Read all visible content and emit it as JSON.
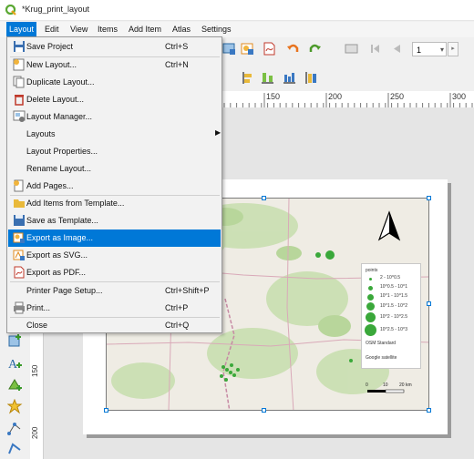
{
  "window": {
    "title": "*Krug_print_layout"
  },
  "menubar": [
    "Layout",
    "Edit",
    "View",
    "Items",
    "Add Item",
    "Atlas",
    "Settings"
  ],
  "layout_menu": {
    "items": [
      {
        "label": "Save Project",
        "shortcut": "Ctrl+S",
        "icon": "save-icon"
      },
      {
        "label": "New Layout...",
        "shortcut": "Ctrl+N",
        "icon": "new-layout-icon"
      },
      {
        "label": "Duplicate Layout...",
        "shortcut": "",
        "icon": "duplicate-icon"
      },
      {
        "label": "Delete Layout...",
        "shortcut": "",
        "icon": "delete-icon"
      },
      {
        "label": "Layout Manager...",
        "shortcut": "",
        "icon": "layout-manager-icon"
      },
      {
        "label": "Layouts",
        "shortcut": "",
        "icon": ""
      },
      {
        "label": "Layout Properties...",
        "shortcut": "",
        "icon": ""
      },
      {
        "label": "Rename Layout...",
        "shortcut": "",
        "icon": ""
      },
      {
        "label": "Add Pages...",
        "shortcut": "",
        "icon": "add-pages-icon"
      },
      {
        "label": "Add Items from Template...",
        "shortcut": "",
        "icon": "folder-icon"
      },
      {
        "label": "Save as Template...",
        "shortcut": "",
        "icon": "save-template-icon"
      },
      {
        "label": "Export as Image...",
        "shortcut": "",
        "icon": "export-image-icon"
      },
      {
        "label": "Export as SVG...",
        "shortcut": "",
        "icon": "export-svg-icon"
      },
      {
        "label": "Export as PDF...",
        "shortcut": "",
        "icon": "export-pdf-icon"
      },
      {
        "label": "Printer Page Setup...",
        "shortcut": "Ctrl+Shift+P",
        "icon": ""
      },
      {
        "label": "Print...",
        "shortcut": "Ctrl+P",
        "icon": "print-icon"
      },
      {
        "label": "Close",
        "shortcut": "Ctrl+Q",
        "icon": ""
      }
    ],
    "highlighted": "Export as Image..."
  },
  "toolbar": {
    "page_value": "1"
  },
  "ruler_top": [
    "150",
    "200",
    "250",
    "300"
  ],
  "ruler_left": [
    "150",
    "200"
  ],
  "map_legend": {
    "title": "points",
    "entries": [
      "2 - 10^0.5",
      "10^0.5 - 10^1",
      "10^1 - 10^1.5",
      "10^1.5 - 10^2",
      "10^2 - 10^2.5",
      "10^2.5 - 10^3"
    ],
    "basemaps": [
      "OSM Standard",
      "Google satellite"
    ]
  },
  "scalebar": {
    "labels": [
      "0",
      "10",
      "20 km"
    ]
  },
  "colors": {
    "accent": "#0078d7",
    "points": "#3aa83a"
  }
}
